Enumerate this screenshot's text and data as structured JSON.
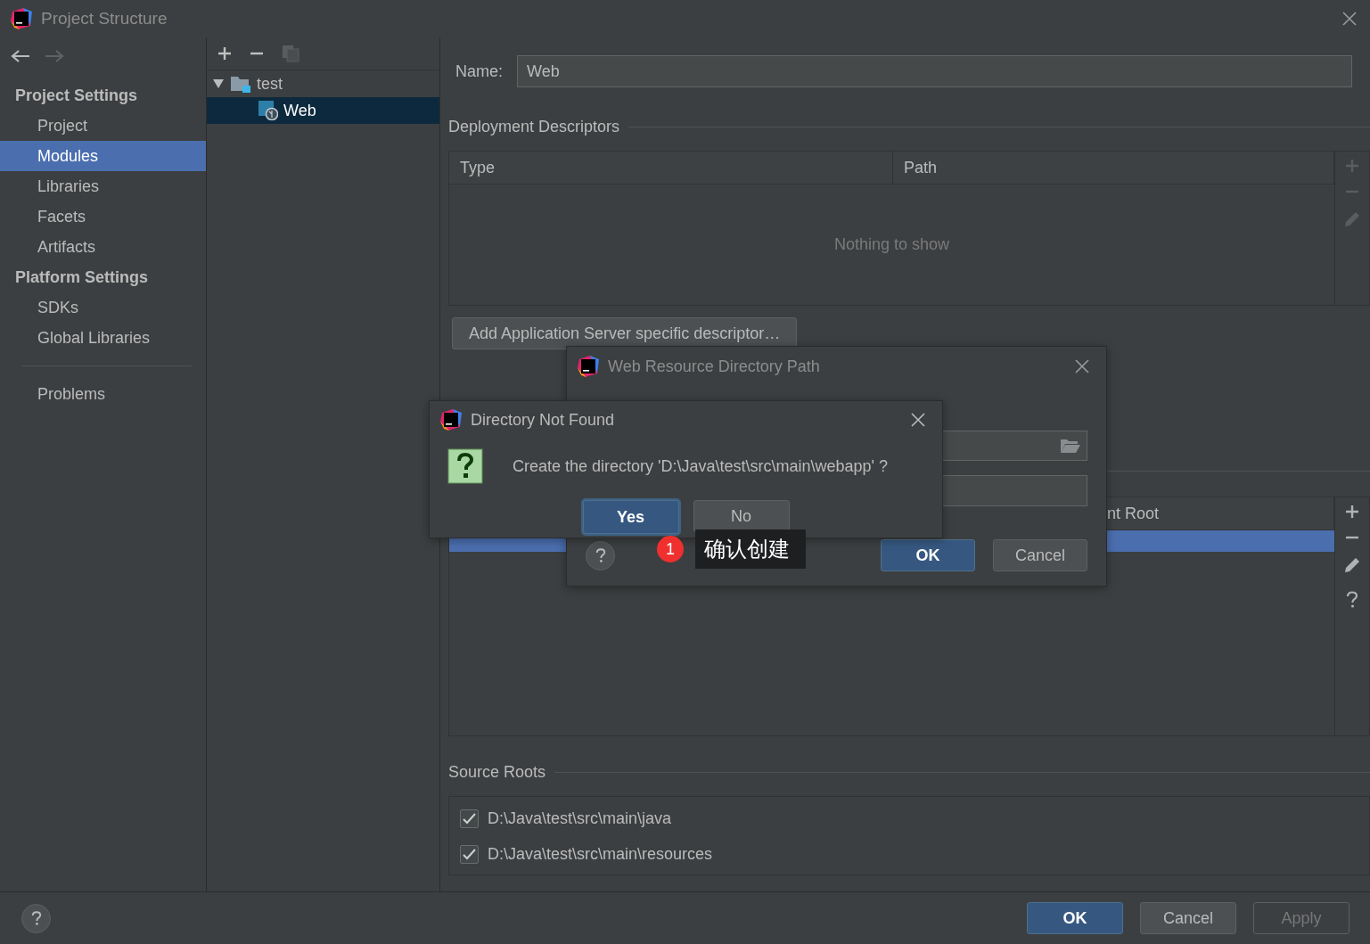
{
  "window": {
    "title": "Project Structure"
  },
  "sidebar": {
    "sections": [
      {
        "title": "Project Settings",
        "items": [
          {
            "label": "Project",
            "selected": false
          },
          {
            "label": "Modules",
            "selected": true
          },
          {
            "label": "Libraries",
            "selected": false
          },
          {
            "label": "Facets",
            "selected": false
          },
          {
            "label": "Artifacts",
            "selected": false
          }
        ]
      },
      {
        "title": "Platform Settings",
        "items": [
          {
            "label": "SDKs",
            "selected": false
          },
          {
            "label": "Global Libraries",
            "selected": false
          }
        ]
      }
    ],
    "extra_items": [
      {
        "label": "Problems",
        "selected": false
      }
    ]
  },
  "tree": {
    "nodes": [
      {
        "label": "test",
        "expanded": true,
        "selected": false,
        "children": [
          {
            "label": "Web",
            "selected": true
          }
        ]
      }
    ]
  },
  "module": {
    "name_label": "Name:",
    "name_value": "Web",
    "deployment": {
      "title": "Deployment Descriptors",
      "columns": [
        "Type",
        "Path"
      ],
      "empty_text": "Nothing to show",
      "add_button": "Add Application Server specific descriptor…"
    },
    "web_resource_table": {
      "column_2": "nt Root",
      "rows": [
        {
          "selected": true
        }
      ]
    },
    "source_roots": {
      "title": "Source Roots",
      "items": [
        {
          "path": "D:\\Java\\test\\src\\main\\java",
          "checked": true
        },
        {
          "path": "D:\\Java\\test\\src\\main\\resources",
          "checked": true
        }
      ]
    }
  },
  "footer": {
    "buttons": [
      {
        "label": "OK",
        "default": true,
        "disabled": false
      },
      {
        "label": "Cancel",
        "default": false,
        "disabled": false
      },
      {
        "label": "Apply",
        "default": false,
        "disabled": true
      }
    ]
  },
  "path_dialog": {
    "title": "Web Resource Directory Path",
    "buttons": [
      {
        "label": "OK",
        "default": true
      },
      {
        "label": "Cancel",
        "default": false
      }
    ]
  },
  "confirm_dialog": {
    "title": "Directory Not Found",
    "message": "Create the directory 'D:\\Java\\test\\src\\main\\webapp' ?",
    "buttons": [
      {
        "label": "Yes",
        "default": true
      },
      {
        "label": "No",
        "default": false
      }
    ]
  },
  "callout": {
    "badge": "1",
    "text": "确认创建"
  }
}
